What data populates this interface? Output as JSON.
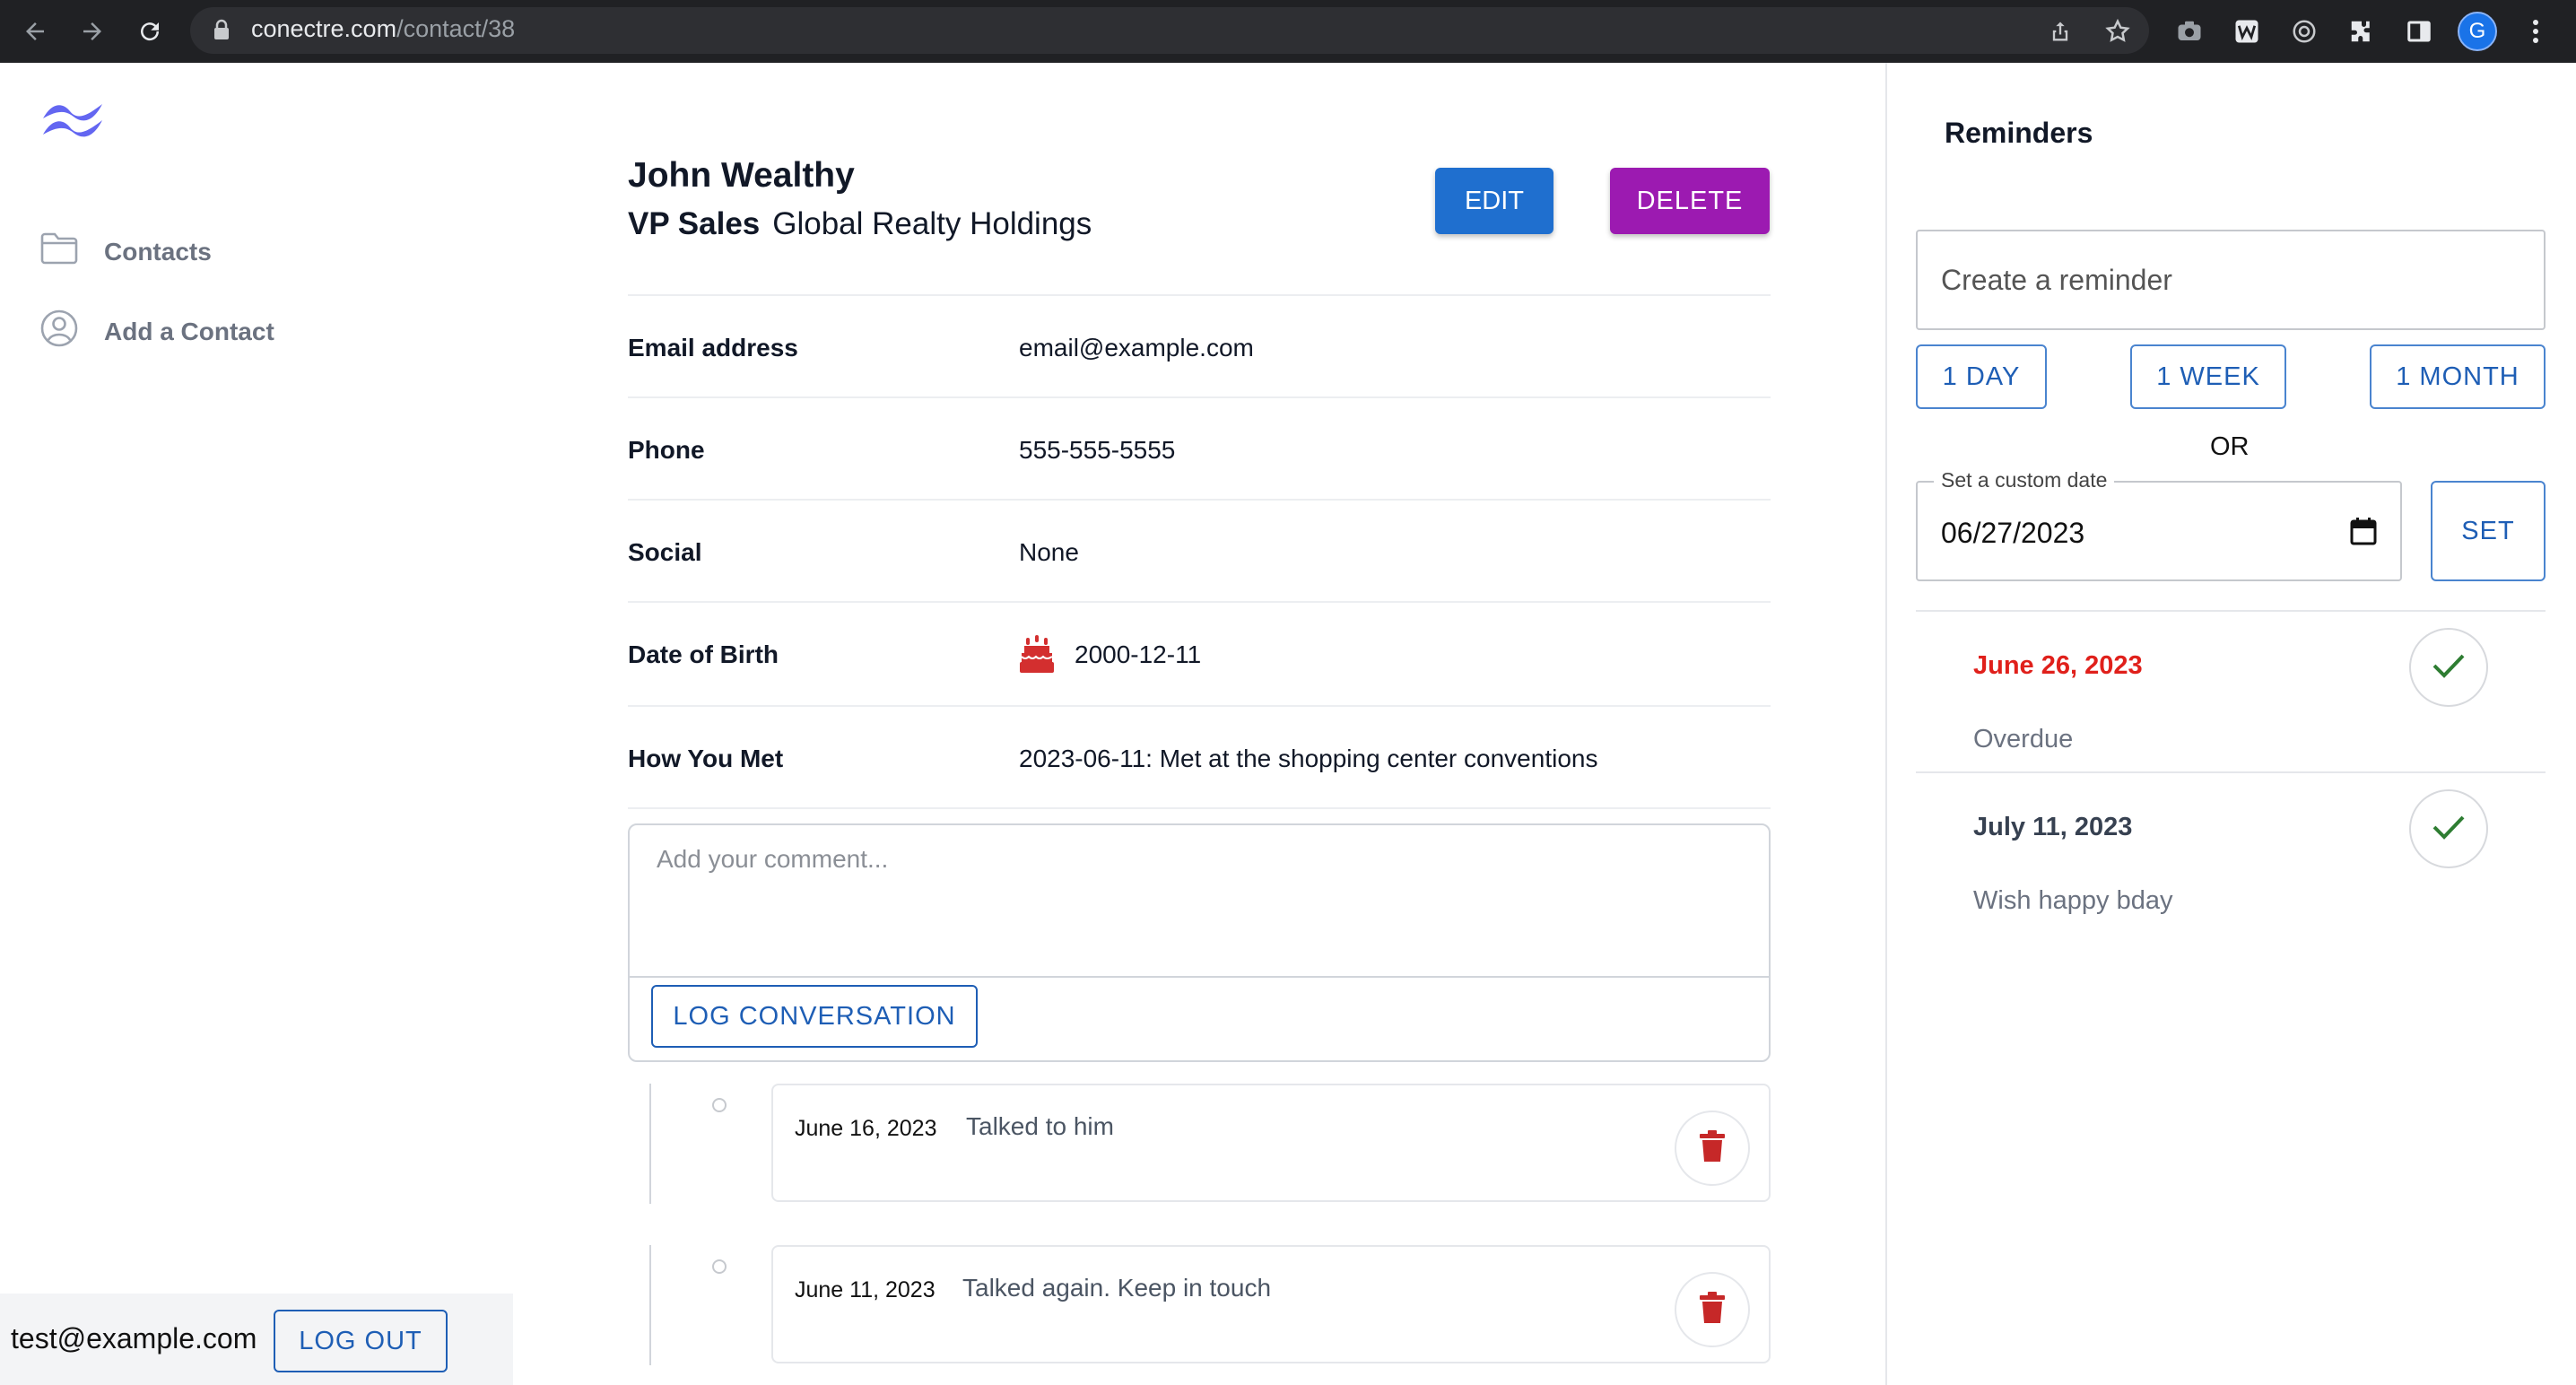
{
  "browser": {
    "domain": "conectre.com",
    "path": "/contact/38",
    "profile_initial": "G"
  },
  "sidebar": {
    "items": [
      {
        "label": "Contacts",
        "icon": "folder-icon"
      },
      {
        "label": "Add a Contact",
        "icon": "user-circle-icon"
      }
    ],
    "user_email": "test@example.com",
    "logout_label": "LOG OUT"
  },
  "contact": {
    "name": "John Wealthy",
    "role": "VP Sales",
    "company": "Global Realty Holdings",
    "edit_label": "EDIT",
    "delete_label": "DELETE",
    "details": [
      {
        "label": "Email address",
        "value": "email@example.com"
      },
      {
        "label": "Phone",
        "value": "555-555-5555"
      },
      {
        "label": "Social",
        "value": "None"
      },
      {
        "label": "Date of Birth",
        "value": "2000-12-11"
      },
      {
        "label": "How You Met",
        "value": "2023-06-11: Met at the shopping center conventions"
      }
    ]
  },
  "comment": {
    "placeholder": "Add your comment...",
    "log_label": "LOG CONVERSATION"
  },
  "logs": [
    {
      "date": "June 16, 2023",
      "text": "Talked to him"
    },
    {
      "date": "June 11, 2023",
      "text": "Talked again. Keep in touch"
    }
  ],
  "reminders": {
    "title": "Reminders",
    "placeholder": "Create a reminder",
    "quick": [
      "1 DAY",
      "1 WEEK",
      "1 MONTH"
    ],
    "or_label": "OR",
    "custom_label": "Set a custom date",
    "custom_value": "06/27/2023",
    "set_label": "SET",
    "items": [
      {
        "date": "June 26, 2023",
        "note": "Overdue",
        "date_color": "#e0201b"
      },
      {
        "date": "July 11, 2023",
        "note": "Wish happy bday",
        "date_color": "#374151"
      }
    ]
  },
  "colors": {
    "primary": "#1f6fcf",
    "danger_button": "#9c1ab1",
    "overdue": "#e0201b",
    "check": "#2e7d32",
    "trash": "#c62828"
  }
}
